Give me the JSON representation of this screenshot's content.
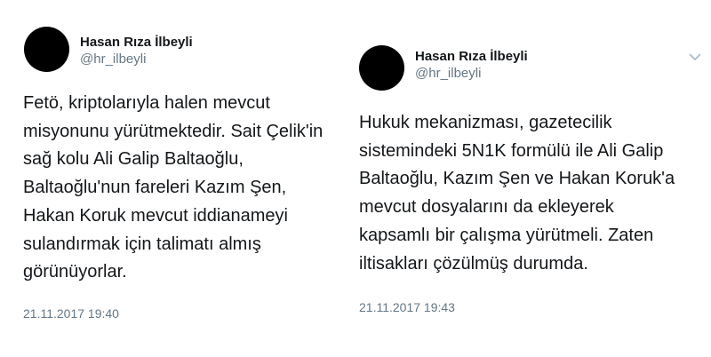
{
  "tweets": [
    {
      "author_name": "Hasan Rıza İlbeyli",
      "handle": "@hr_ilbeyli",
      "text": "Fetö, kriptolarıyla halen mevcut\nmisyonunu yürütmektedir. Sait Çelik'in\nsağ kolu Ali Galip Baltaoğlu,\nBaltaoğlu'nun fareleri Kazım Şen,\nHakan Koruk mevcut iddianameyi\nsulandırmak için talimatı almış\ngörünüyorlar.",
      "timestamp": "21.11.2017 19:40",
      "menu_icon": "chevron-down-icon"
    },
    {
      "author_name": "Hasan Rıza İlbeyli",
      "handle": "@hr_ilbeyli",
      "text": "Hukuk mekanizması, gazetecilik\nsistemindeki 5N1K formülü ile Ali Galip\nBaltaoğlu, Kazım Şen ve Hakan Koruk'a\nmevcut dosyalarını da ekleyerek\nkapsamlı bir çalışma yürütmeli. Zaten\niltisakları çözülmüş durumda.",
      "timestamp": "21.11.2017 19:43",
      "menu_icon": "chevron-down-icon"
    }
  ],
  "colors": {
    "text": "#14171a",
    "secondary": "#657786",
    "avatar": "#000000",
    "chevron": "#aab8c2"
  }
}
